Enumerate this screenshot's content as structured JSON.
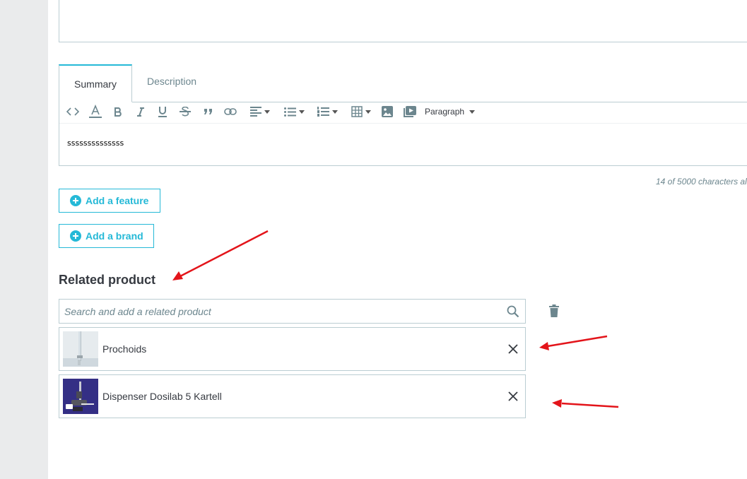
{
  "editor": {
    "tabs": [
      {
        "label": "Summary",
        "active": true
      },
      {
        "label": "Description",
        "active": false
      }
    ],
    "toolbar": {
      "format_select": "Paragraph",
      "icons": [
        "code-icon",
        "text-color-icon",
        "bold-icon",
        "italic-icon",
        "underline-icon",
        "strikethrough-icon",
        "blockquote-icon",
        "link-icon",
        "align-icon",
        "bullet-list-icon",
        "numbered-list-icon",
        "table-icon",
        "image-icon",
        "media-icon"
      ]
    },
    "content": "ssssssssssssss",
    "char_count": "14 of 5000 characters al"
  },
  "buttons": {
    "add_feature": "Add a feature",
    "add_brand": "Add a brand"
  },
  "related": {
    "title": "Related product",
    "search_placeholder": "Search and add a related product",
    "items": [
      {
        "name": "Prochoids"
      },
      {
        "name": "Dispenser Dosilab 5 Kartell"
      }
    ]
  },
  "colors": {
    "accent": "#25b9d7",
    "border": "#bbcdd2",
    "annotation_arrow": "#e3141a"
  }
}
